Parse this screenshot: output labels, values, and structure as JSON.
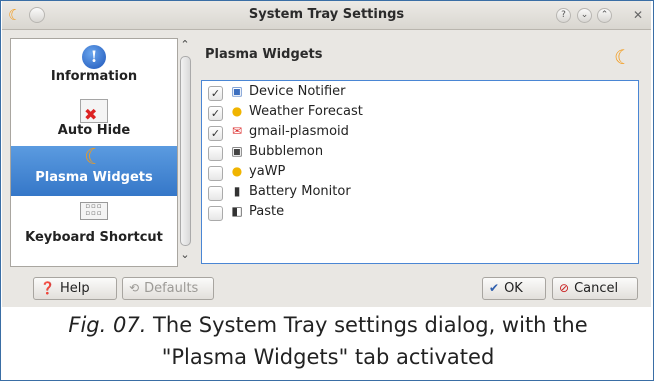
{
  "window": {
    "title": "System Tray Settings",
    "tb_help": "?",
    "tb_min": "⌄",
    "tb_max": "⌃",
    "tb_close": "✕"
  },
  "sidebar": {
    "items": [
      {
        "label": "Information",
        "icon": "info-icon"
      },
      {
        "label": "Auto Hide",
        "icon": "auto-hide-icon"
      },
      {
        "label": "Plasma Widgets",
        "icon": "plasma-widgets-icon",
        "active": true
      },
      {
        "label": "Keyboard Shortcut",
        "icon": "keyboard-icon"
      }
    ]
  },
  "panel": {
    "title": "Plasma Widgets",
    "widgets": [
      {
        "label": "Device Notifier",
        "checked": true,
        "icon": "device-notifier-icon"
      },
      {
        "label": "Weather Forecast",
        "checked": true,
        "icon": "weather-icon"
      },
      {
        "label": "gmail-plasmoid",
        "checked": true,
        "icon": "mail-icon"
      },
      {
        "label": "Bubblemon",
        "checked": false,
        "icon": "bubblemon-icon"
      },
      {
        "label": "yaWP",
        "checked": false,
        "icon": "weather-icon"
      },
      {
        "label": "Battery Monitor",
        "checked": false,
        "icon": "battery-icon"
      },
      {
        "label": "Paste",
        "checked": false,
        "icon": "paste-icon"
      }
    ]
  },
  "buttons": {
    "help": "Help",
    "defaults": "Defaults",
    "ok": "OK",
    "cancel": "Cancel"
  },
  "caption": {
    "fig": "Fig. 07.",
    "text": " The System Tray settings dialog, with the",
    "line2": "\"Plasma Widgets\" tab activated"
  },
  "colors": {
    "accent": "#3577c8",
    "title_bar": "#d9d6d0",
    "dialog_bg": "#e9e7e3"
  }
}
